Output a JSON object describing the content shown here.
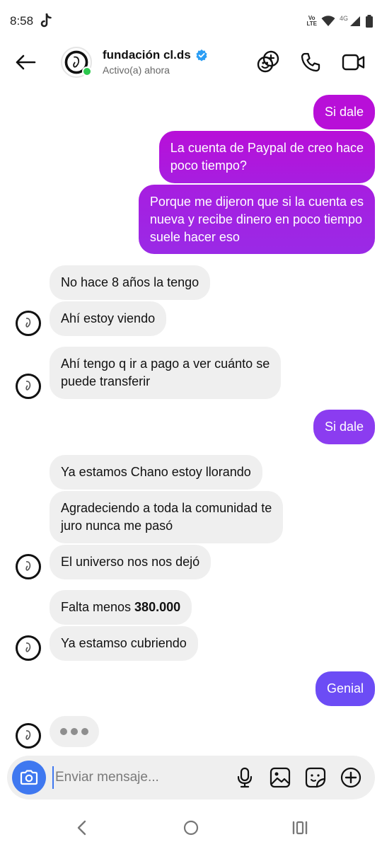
{
  "status_bar": {
    "time": "8:58",
    "volte_top": "Vo",
    "volte_bottom": "LTE",
    "network": "4G"
  },
  "header": {
    "name": "fundación cl.ds",
    "status": "Activo(a) ahora",
    "icons": [
      "back-arrow-icon",
      "verified-icon",
      "effects-icon",
      "phone-icon",
      "video-icon"
    ]
  },
  "messages": [
    {
      "id": "m1",
      "side": "out",
      "text": "Si dale"
    },
    {
      "id": "m2",
      "side": "out",
      "lines": [
        "La cuenta de Paypal de creo hace",
        "poco tiempo?"
      ]
    },
    {
      "id": "m3",
      "side": "out",
      "lines": [
        "Porque me dijeron que si la cuenta es",
        "nueva y recibe dinero en poco tiempo",
        "suele hacer eso"
      ]
    },
    {
      "id": "m4",
      "side": "in",
      "text": "No hace 8 años la tengo"
    },
    {
      "id": "m5",
      "side": "in",
      "text": "Ahí estoy viendo"
    },
    {
      "id": "m6",
      "side": "in",
      "lines": [
        "Ahí tengo q ir a pago a ver cuánto se",
        "puede transferir"
      ]
    },
    {
      "id": "m7",
      "side": "out",
      "text": "Si dale"
    },
    {
      "id": "m8",
      "side": "in",
      "text": "Ya estamos Chano estoy llorando"
    },
    {
      "id": "m9",
      "side": "in",
      "lines": [
        "Agradeciendo a toda la comunidad te",
        "juro nunca me pasó"
      ]
    },
    {
      "id": "m10",
      "side": "in",
      "text": "El universo nos nos dejó"
    },
    {
      "id": "m11",
      "side": "in",
      "prefix": "Falta menos ",
      "bold": "380.000"
    },
    {
      "id": "m12",
      "side": "in",
      "text": "Ya estamso cubriendo"
    },
    {
      "id": "m13",
      "side": "out",
      "text": "Genial"
    }
  ],
  "colors": {
    "out_top": "#b80fd8",
    "out_mid": "#8b3cf0",
    "out_bottom": "#6c4cf5",
    "incoming": "#efefef",
    "camera_button": "#3f78f0",
    "online": "#2cc84d",
    "verified": "#2a9df4"
  },
  "composer": {
    "placeholder": "Enviar mensaje...",
    "icons": [
      "camera-icon",
      "microphone-icon",
      "gallery-icon",
      "sticker-icon",
      "plus-icon"
    ]
  },
  "navbar": {
    "icons": [
      "back-nav-icon",
      "home-nav-icon",
      "recents-nav-icon"
    ]
  }
}
